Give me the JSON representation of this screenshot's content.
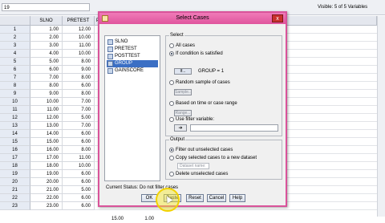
{
  "header": {
    "cell_ref": "19",
    "visible_label": "Visible: 5 of 5 Variables"
  },
  "grid": {
    "columns": [
      "SLNO",
      "PRETEST",
      "P"
    ],
    "rows": [
      {
        "n": "1",
        "slno": "1.00",
        "pretest": "12.00"
      },
      {
        "n": "2",
        "slno": "2.00",
        "pretest": "10.00"
      },
      {
        "n": "3",
        "slno": "3.00",
        "pretest": "11.00"
      },
      {
        "n": "4",
        "slno": "4.00",
        "pretest": "10.00"
      },
      {
        "n": "5",
        "slno": "5.00",
        "pretest": "8.00"
      },
      {
        "n": "6",
        "slno": "6.00",
        "pretest": "9.00"
      },
      {
        "n": "7",
        "slno": "7.00",
        "pretest": "8.00"
      },
      {
        "n": "8",
        "slno": "8.00",
        "pretest": "6.00"
      },
      {
        "n": "9",
        "slno": "9.00",
        "pretest": "8.00"
      },
      {
        "n": "10",
        "slno": "10.00",
        "pretest": "7.00"
      },
      {
        "n": "11",
        "slno": "11.00",
        "pretest": "7.00"
      },
      {
        "n": "12",
        "slno": "12.00",
        "pretest": "5.00"
      },
      {
        "n": "13",
        "slno": "13.00",
        "pretest": "7.00"
      },
      {
        "n": "14",
        "slno": "14.00",
        "pretest": "6.00"
      },
      {
        "n": "15",
        "slno": "15.00",
        "pretest": "6.00"
      },
      {
        "n": "16",
        "slno": "16.00",
        "pretest": "8.00"
      },
      {
        "n": "17",
        "slno": "17.00",
        "pretest": "11.00"
      },
      {
        "n": "18",
        "slno": "18.00",
        "pretest": "10.00"
      },
      {
        "n": "19",
        "slno": "19.00",
        "pretest": "6.00"
      },
      {
        "n": "20",
        "slno": "20.00",
        "pretest": "6.00"
      },
      {
        "n": "21",
        "slno": "21.00",
        "pretest": "5.00"
      },
      {
        "n": "22",
        "slno": "22.00",
        "pretest": "6.00"
      },
      {
        "n": "23",
        "slno": "23.00",
        "pretest": "6.00"
      }
    ],
    "ghost_values": [
      "15.00",
      "1.00"
    ]
  },
  "dialog": {
    "title": "Select Cases",
    "close_glyph": "x",
    "variables": [
      {
        "name": "SLNO"
      },
      {
        "name": "PRETEST"
      },
      {
        "name": "POSTTEST"
      },
      {
        "name": "GROUP"
      },
      {
        "name": "GAINSCORE"
      }
    ],
    "select_label": "Select",
    "opt_all": "All cases",
    "opt_if": "If condition is satisfied",
    "if_button": "If...",
    "if_condition": "GROUP = 1",
    "opt_random": "Random sample of cases",
    "sample_button": "Sample...",
    "opt_range": "Based on time or case range",
    "range_button": "Range...",
    "opt_filter": "Use filter variable:",
    "arrow_glyph": "➔",
    "output_label": "Output",
    "out_filter": "Filter out unselected cases",
    "out_copy": "Copy selected cases to a new dataset",
    "dataset_placeholder": "Dataset name:",
    "out_delete": "Delete unselected cases",
    "status": "Current Status: Do not filter cases",
    "buttons": {
      "ok": "OK",
      "paste": "Paste",
      "reset": "Reset",
      "cancel": "Cancel",
      "help": "Help"
    }
  },
  "colors": {
    "title_bar": "#e0559d",
    "dialog_border": "#d9539a",
    "selected_item": "#3b6fc4",
    "highlight": "#f2d200"
  }
}
